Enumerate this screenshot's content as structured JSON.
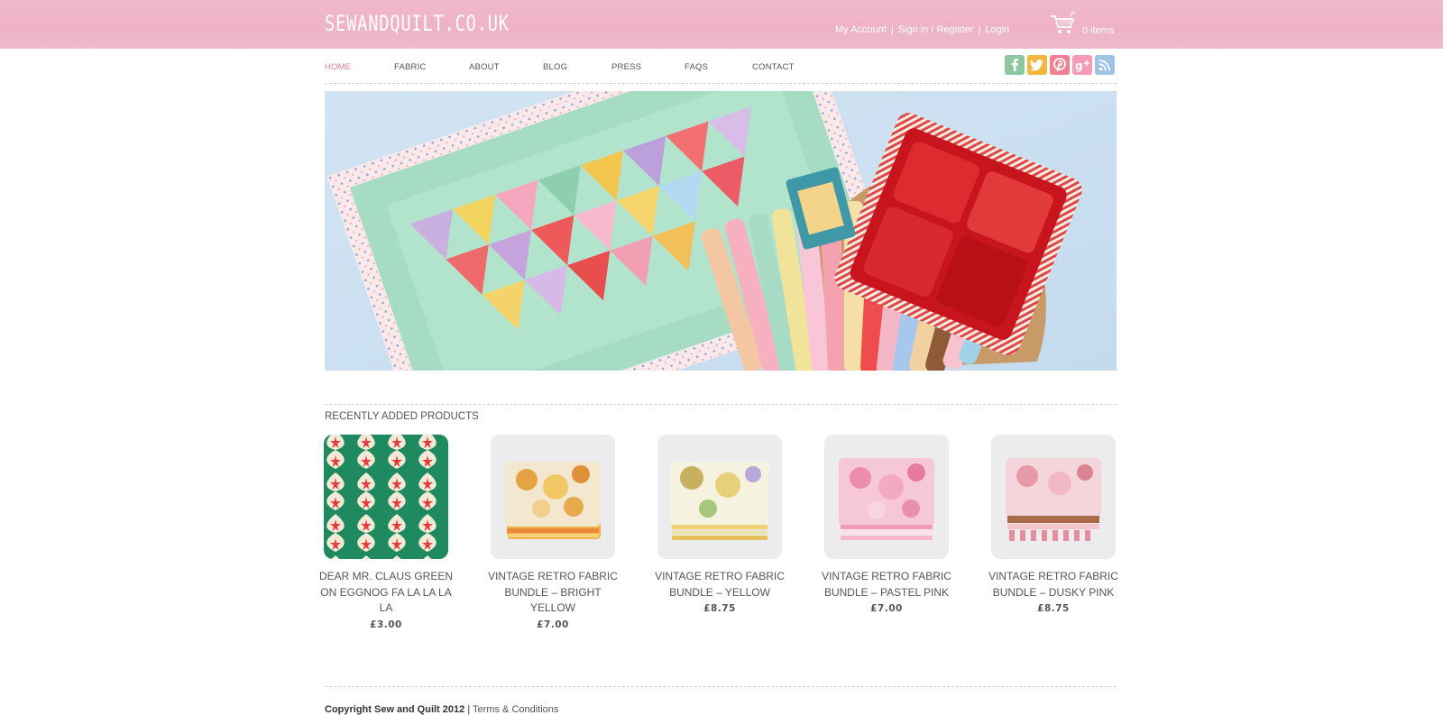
{
  "header": {
    "logo": "SEWANDQUILT.CO.UK",
    "links": [
      "My Account",
      "Sign in / Register",
      "Login"
    ],
    "cart_count": "0 items"
  },
  "nav": {
    "items": [
      "HOME",
      "FABRIC",
      "ABOUT",
      "BLOG",
      "PRESS",
      "FAQS",
      "CONTACT"
    ],
    "active": "HOME"
  },
  "social": [
    "facebook-icon",
    "twitter-icon",
    "pinterest-icon",
    "google-plus-icon",
    "rss-icon"
  ],
  "section": {
    "title": "RECENTLY ADDED PRODUCTS"
  },
  "products": [
    {
      "name": "DEAR MR. CLAUS GREEN ON EGGNOG FA LA LA LA LA",
      "price": "£3.00"
    },
    {
      "name": "VINTAGE RETRO FABRIC BUNDLE – BRIGHT YELLOW",
      "price": "£7.00"
    },
    {
      "name": "VINTAGE RETRO FABRIC BUNDLE – YELLOW",
      "price": "£8.75"
    },
    {
      "name": "VINTAGE RETRO FABRIC BUNDLE – PASTEL PINK",
      "price": "£7.00"
    },
    {
      "name": "VINTAGE RETRO FABRIC BUNDLE – DUSKY PINK",
      "price": "£8.75"
    }
  ],
  "footer": {
    "copyright": "Copyright Sew and Quilt 2012",
    "separator": "|",
    "terms": "Terms & Conditions"
  },
  "colors": {
    "topbar": "#efb8c8",
    "accent": "#e07a98",
    "text": "#555555"
  }
}
